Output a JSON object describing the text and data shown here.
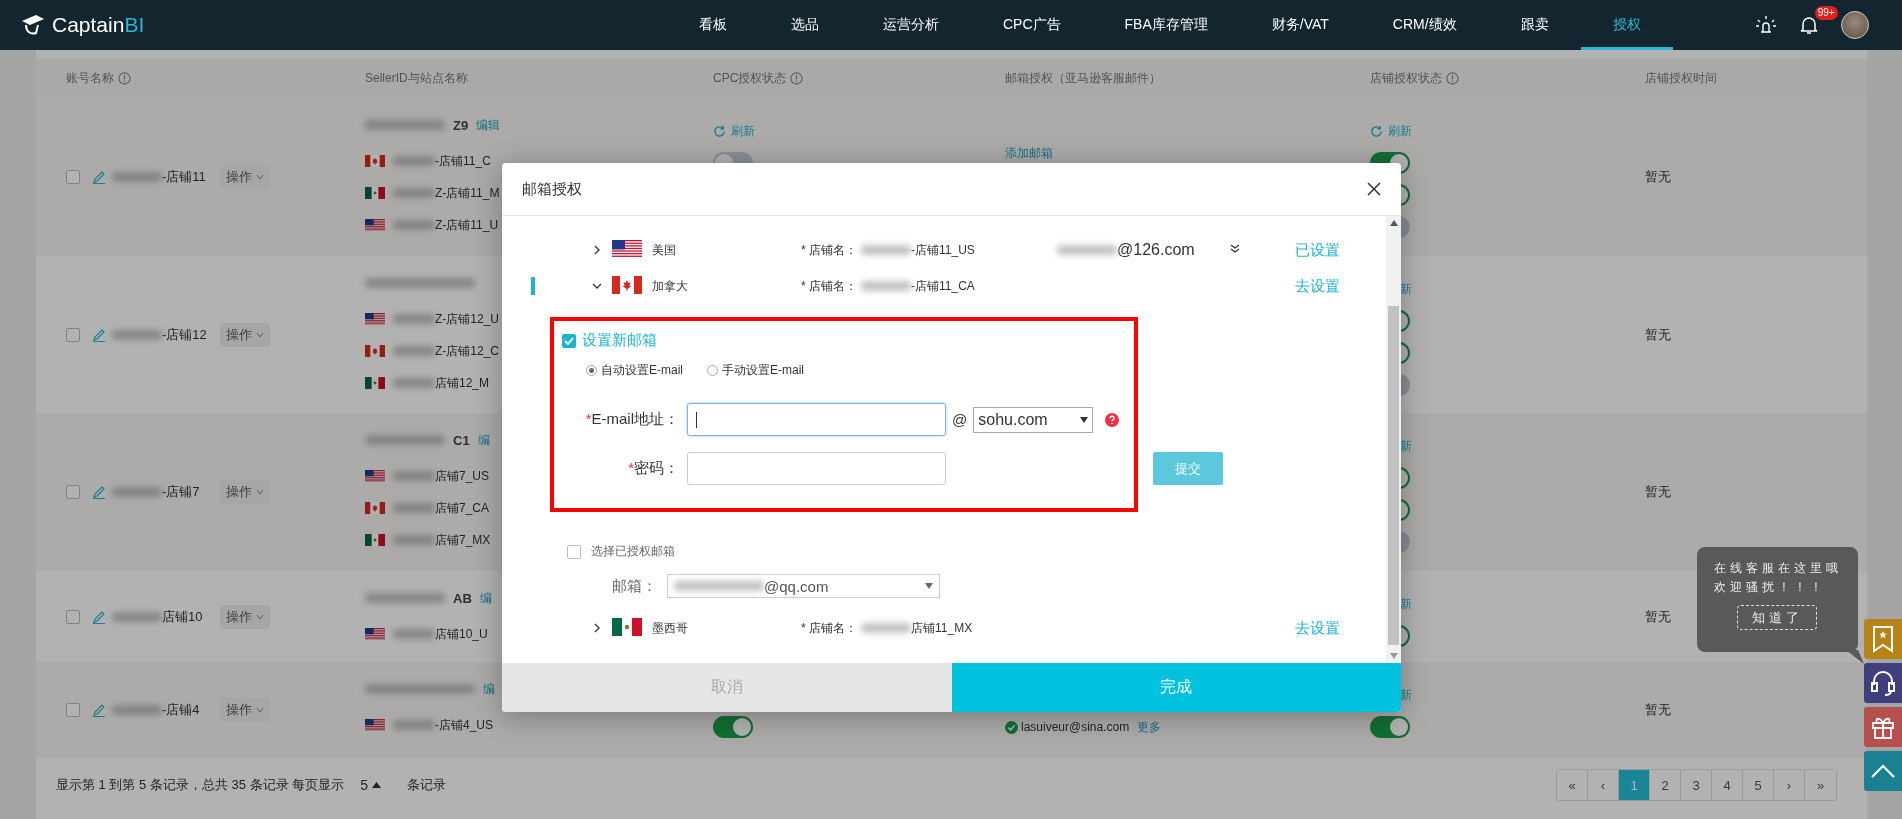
{
  "header": {
    "logo": {
      "main": "Captain",
      "accent": "BI"
    },
    "nav": [
      {
        "label": "看板",
        "selected": false
      },
      {
        "label": "选品",
        "selected": false
      },
      {
        "label": "运营分析",
        "selected": false
      },
      {
        "label": "CPC广告",
        "selected": false
      },
      {
        "label": "FBA库存管理",
        "selected": false
      },
      {
        "label": "财务/VAT",
        "selected": false
      },
      {
        "label": "CRM/绩效",
        "selected": false
      },
      {
        "label": "跟卖",
        "selected": false
      },
      {
        "label": "授权",
        "selected": true
      }
    ],
    "badge": "99+"
  },
  "table": {
    "columns": [
      {
        "label": "账号名称",
        "info": true
      },
      {
        "label": "SellerID与站点名称"
      },
      {
        "label": "CPC授权状态",
        "info": true
      },
      {
        "label": "邮箱授权（亚马逊客服邮件）"
      },
      {
        "label": "店铺授权状态",
        "info": true
      },
      {
        "label": "店铺授权时间"
      }
    ],
    "rows": [
      {
        "checked": false,
        "name": "-店铺11",
        "action": "操作",
        "seller_suffix": "Z9",
        "edit": "编辑",
        "stores": [
          {
            "kind": "ca",
            "name": "-店铺11_C"
          },
          {
            "kind": "mx",
            "name": "Z-店铺11_M"
          },
          {
            "kind": "us",
            "name": "Z-店铺11_U"
          }
        ],
        "cpc": {
          "refresh": "刷新",
          "toggles": [
            {
              "on": false
            }
          ]
        },
        "email": {
          "add": "添加邮箱"
        },
        "store_auth": {
          "refresh": "刷新",
          "show_icon": true,
          "toggles": [
            {
              "on": true
            },
            {
              "on": true
            },
            {
              "on": false
            }
          ]
        },
        "auth_time": "暂无"
      },
      {
        "checked": false,
        "name": "-店铺12",
        "action": "操作",
        "stores": [
          {
            "kind": "us",
            "name": "Z-店铺12_U"
          },
          {
            "kind": "ca",
            "name": "Z-店铺12_C"
          },
          {
            "kind": "mx",
            "name": "店铺12_M"
          }
        ],
        "store_auth": {
          "refresh": "新",
          "show_icon": false,
          "toggles": [
            {
              "on": true
            },
            {
              "on": true
            },
            {
              "on": false
            }
          ]
        },
        "auth_time": "暂无"
      },
      {
        "checked": false,
        "name": "-店铺7",
        "action": "操作",
        "seller_suffix": "C1",
        "edit": "编",
        "stores": [
          {
            "kind": "us",
            "name": "店铺7_US"
          },
          {
            "kind": "ca",
            "name": "店铺7_CA"
          },
          {
            "kind": "mx",
            "name": "店铺7_MX"
          }
        ],
        "store_auth": {
          "refresh": "新",
          "show_icon": false,
          "toggles": [
            {
              "on": true
            },
            {
              "on": true
            },
            {
              "on": false
            }
          ]
        },
        "auth_time": "暂无"
      },
      {
        "checked": false,
        "name": "店铺10",
        "action": "操作",
        "seller_suffix": "AB",
        "edit": "编",
        "stores": [
          {
            "kind": "us",
            "name": "店铺10_U"
          }
        ],
        "store_auth": {
          "refresh": "新",
          "show_icon": false,
          "toggles": [
            {
              "on": true
            }
          ]
        },
        "auth_time": "暂无"
      },
      {
        "checked": false,
        "name": "-店铺4",
        "action": "操作",
        "edit": "编",
        "stores": [
          {
            "kind": "us",
            "name": "-店铺4_US"
          }
        ],
        "cpc": {
          "toggles": [
            {
              "on": true
            }
          ]
        },
        "email": {
          "address": "lasuiveur@sina.com",
          "more": "更多"
        },
        "store_auth": {
          "refresh": "新",
          "show_icon": false,
          "toggles": [
            {
              "on": true
            }
          ]
        },
        "auth_time": "暂无"
      }
    ]
  },
  "footer": {
    "summary": "显示第 1 到第 5 条记录，总共 35 条记录 每页显示",
    "page_size": "5",
    "suffix": "条记录"
  },
  "pagination": [
    {
      "label": "«",
      "selected": false
    },
    {
      "label": "‹",
      "selected": false
    },
    {
      "label": "1",
      "selected": true
    },
    {
      "label": "2",
      "selected": false
    },
    {
      "label": "3",
      "selected": false
    },
    {
      "label": "4",
      "selected": false
    },
    {
      "label": "5",
      "selected": false
    },
    {
      "label": "›",
      "selected": false
    },
    {
      "label": "»",
      "selected": false
    }
  ],
  "modal": {
    "title": "邮箱授权",
    "sites": [
      {
        "kind": "us",
        "country": "美国",
        "expanded": false,
        "store_label": "* 店铺名：",
        "store_name": "-店铺11_US",
        "email": "@126.com",
        "status": "已设置"
      },
      {
        "kind": "ca",
        "country": "加拿大",
        "expanded": true,
        "store_label": "* 店铺名：",
        "store_name": "-店铺11_CA",
        "status": "去设置",
        "form": {
          "new_mailbox": {
            "label": "设置新邮箱",
            "checked": true
          },
          "modes": [
            {
              "label": "自动设置E-mail",
              "selected": true
            },
            {
              "label": "手动设置E-mail",
              "selected": false
            }
          ],
          "required_mark": "*",
          "email_label": "E-mail地址：",
          "at": "@",
          "domain": "sohu.com",
          "password_label": "密码：",
          "submit": "提交",
          "existing": {
            "label": "选择已授权邮箱",
            "checked": false
          },
          "mailbox_label": "邮箱：",
          "mailbox_value": "@qq.com"
        }
      },
      {
        "kind": "mx",
        "country": "墨西哥",
        "expanded": false,
        "store_label": "* 店铺名：",
        "store_name": "店铺11_MX",
        "status": "去设置"
      }
    ],
    "cancel": "取消",
    "done": "完成"
  },
  "tooltip": {
    "lines": [
      "在线客服在这里哦",
      "欢迎骚扰！！！"
    ],
    "button": "知道了"
  }
}
